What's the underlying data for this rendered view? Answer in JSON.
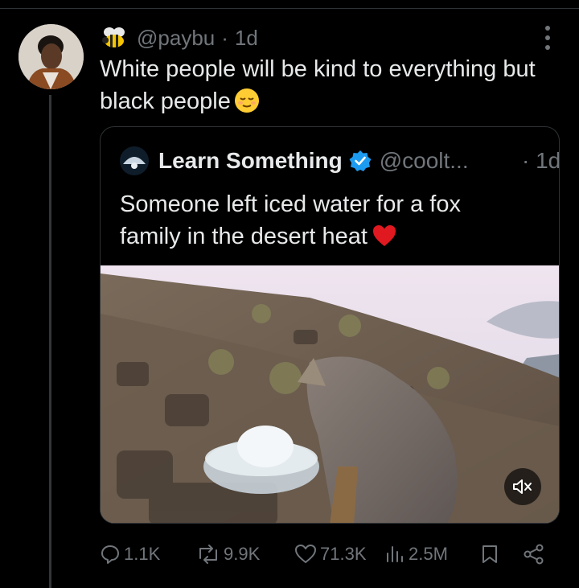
{
  "post": {
    "handle": "@paybu",
    "separator": "·",
    "time": "1d",
    "text": "White people will be kind to everything but black people",
    "badge_icon": "bee-emoji",
    "text_emoji": "relieved-face-emoji"
  },
  "quote": {
    "name": "Learn Something",
    "verified": true,
    "handle": "@coolt...",
    "separator": "·",
    "time": "1d",
    "text": "Someone left iced water for a fox family in the desert heat",
    "text_emoji": "red-heart-emoji",
    "media": {
      "type": "video",
      "description_icon": "fox-drinking-iced-water",
      "muted": true
    }
  },
  "actions": {
    "replies": "1.1K",
    "reposts": "9.9K",
    "likes": "71.3K",
    "views": "2.5M"
  },
  "colors": {
    "background": "#000000",
    "text": "#e7e9ea",
    "muted": "#71767b",
    "border": "#2f3336",
    "verified": "#1d9bf0"
  }
}
